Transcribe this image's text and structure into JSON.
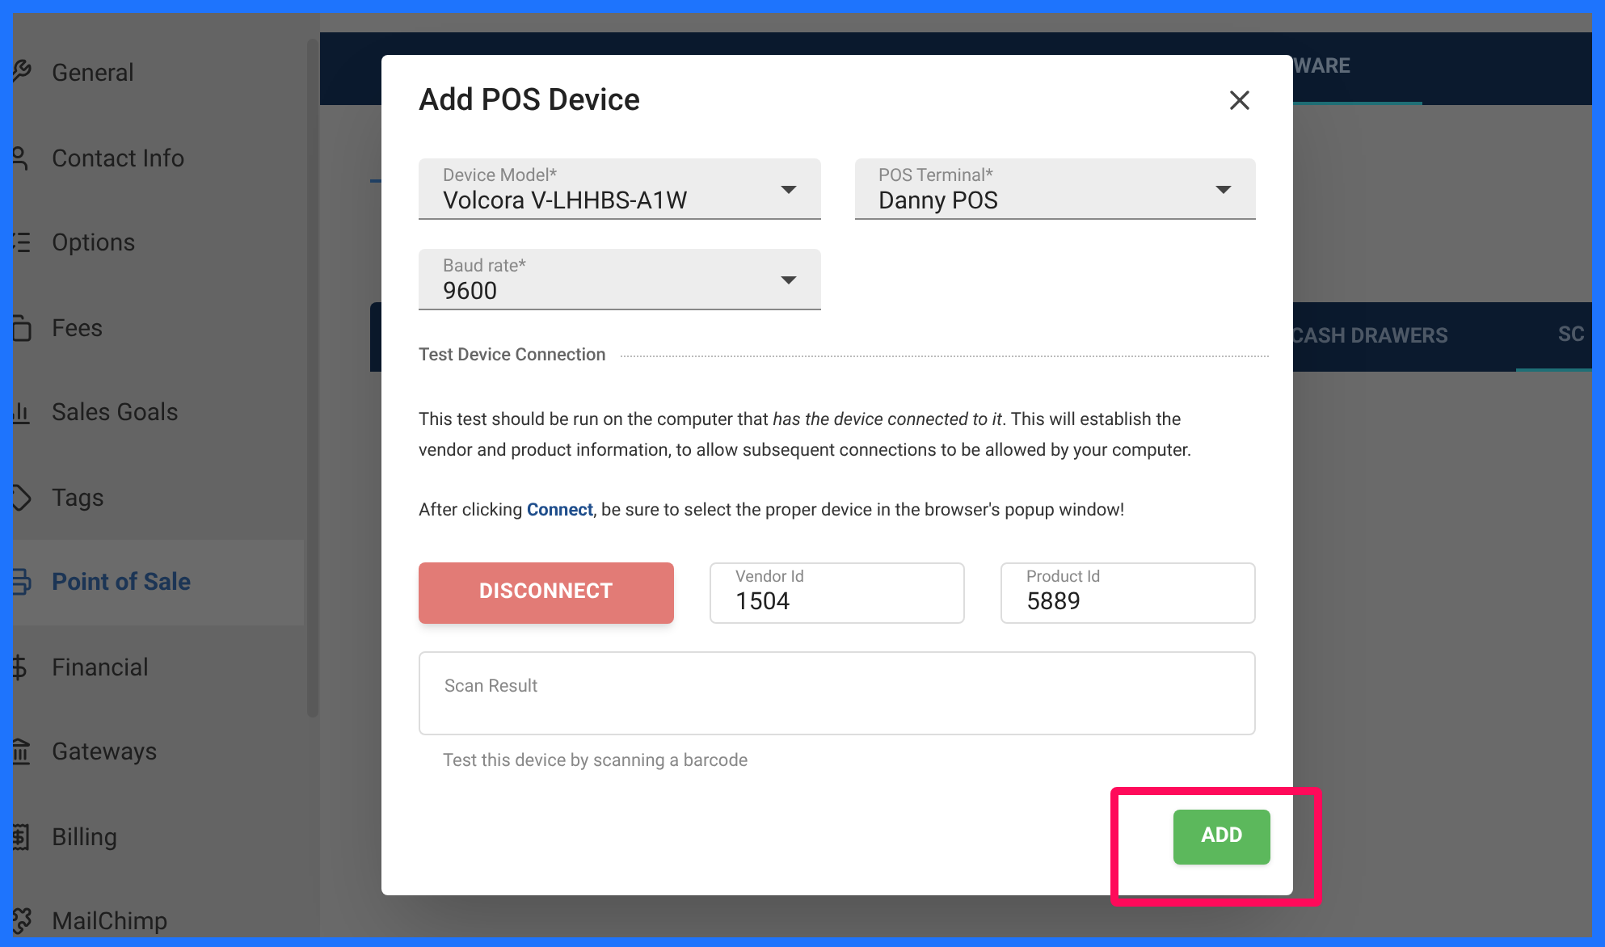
{
  "sidebar": {
    "items": [
      {
        "label": "General",
        "selected": false
      },
      {
        "label": "Contact Info",
        "selected": false
      },
      {
        "label": "Options",
        "selected": false
      },
      {
        "label": "Fees",
        "selected": false
      },
      {
        "label": "Sales Goals",
        "selected": false
      },
      {
        "label": "Tags",
        "selected": false
      },
      {
        "label": "Point of Sale",
        "selected": true
      },
      {
        "label": "Financial",
        "selected": false
      },
      {
        "label": "Gateways",
        "selected": false
      },
      {
        "label": "Billing",
        "selected": false
      },
      {
        "label": "MailChimp",
        "selected": false
      }
    ]
  },
  "top_nav": {
    "tabs": [
      {
        "label": "WARE",
        "selected": true
      }
    ]
  },
  "sub_tabs": [
    {
      "label": "CASH DRAWERS",
      "selected": false
    },
    {
      "label": "SC",
      "selected": true
    }
  ],
  "dialog": {
    "title": "Add POS Device",
    "selects": [
      {
        "label": "Device Model*",
        "value": "Volcora V-LHHBS-A1W"
      },
      {
        "label": "POS Terminal*",
        "value": "Danny POS"
      },
      {
        "label": "Baud rate*",
        "value": "9600"
      }
    ],
    "section_title": "Test Device Connection",
    "paragraphs": [
      "This test should be run on the computer that *has the device connected to it*. This will establish the vendor and product information, to allow subsequent connections to be allowed by your computer."
    ],
    "connect_note": {
      "before": "After clicking ",
      "link": "Connect",
      "after": ", be sure to select the proper device in the browser's popup window!"
    },
    "disconnect_button": "DISCONNECT",
    "id_fields": [
      {
        "label": "Vendor Id",
        "value": "1504"
      },
      {
        "label": "Product Id",
        "value": "5889"
      }
    ],
    "scan_field": {
      "label": "Scan Result",
      "helper": "Test this device by scanning a barcode"
    },
    "add_button": "ADD"
  }
}
